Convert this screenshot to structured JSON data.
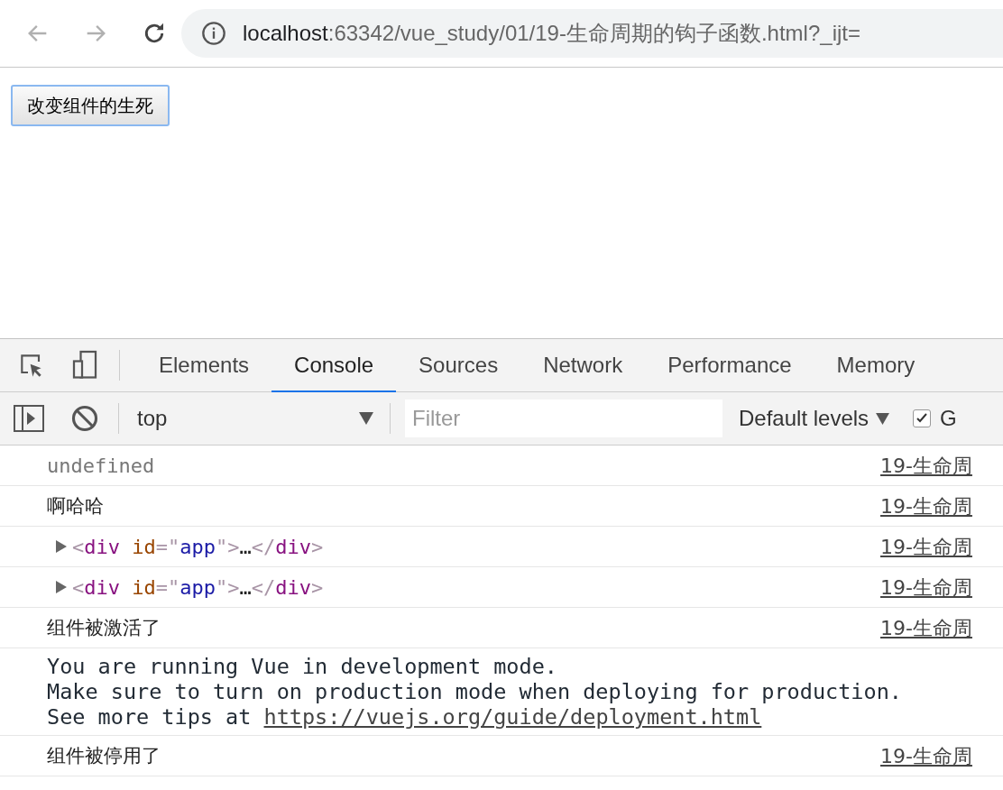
{
  "address_bar": {
    "host": "localhost",
    "path": ":63342/vue_study/01/19-生命周期的钩子函数.html?_ijt="
  },
  "page": {
    "button": "改变组件的生死"
  },
  "devtools": {
    "tabs": [
      {
        "label": "Elements",
        "selected": false
      },
      {
        "label": "Console",
        "selected": true
      },
      {
        "label": "Sources",
        "selected": false
      },
      {
        "label": "Network",
        "selected": false
      },
      {
        "label": "Performance",
        "selected": false
      },
      {
        "label": "Memory",
        "selected": false
      }
    ],
    "toolbar": {
      "context": "top",
      "filter": {
        "placeholder": "Filter"
      },
      "levels": "Default levels",
      "checkbox": {
        "label": "G",
        "checked": true
      }
    },
    "messages": [
      {
        "kind": "result",
        "text": "undefined",
        "source": "19-生命周"
      },
      {
        "kind": "log",
        "text": "啊哈哈",
        "source": "19-生命周"
      },
      {
        "kind": "element",
        "expanded": false,
        "tokens": [
          {
            "text": "<",
            "color": "#a894a6"
          },
          {
            "text": "div",
            "color": "#881280"
          },
          {
            "text": " id",
            "color": "#994500"
          },
          {
            "text": "=\"",
            "color": "#a894a6"
          },
          {
            "text": "app",
            "color": "#1a1aa6"
          },
          {
            "text": "\">",
            "color": "#a894a6"
          },
          {
            "text": "…",
            "color": "#222222"
          },
          {
            "text": "</",
            "color": "#a894a6"
          },
          {
            "text": "div",
            "color": "#881280"
          },
          {
            "text": ">",
            "color": "#a894a6"
          }
        ],
        "source": "19-生命周"
      },
      {
        "kind": "element",
        "expanded": false,
        "tokens": [
          {
            "text": "<",
            "color": "#a894a6"
          },
          {
            "text": "div",
            "color": "#881280"
          },
          {
            "text": " id",
            "color": "#994500"
          },
          {
            "text": "=\"",
            "color": "#a894a6"
          },
          {
            "text": "app",
            "color": "#1a1aa6"
          },
          {
            "text": "\">",
            "color": "#a894a6"
          },
          {
            "text": "…",
            "color": "#222222"
          },
          {
            "text": "</",
            "color": "#a894a6"
          },
          {
            "text": "div",
            "color": "#881280"
          },
          {
            "text": ">",
            "color": "#a894a6"
          }
        ],
        "source": "19-生命周"
      },
      {
        "kind": "log",
        "text": "组件被激活了",
        "source": "19-生命周"
      },
      {
        "kind": "notice",
        "lines": [
          "You are running Vue in development mode.",
          "Make sure to turn on production mode when deploying for production.",
          "See more tips at "
        ],
        "link": "https://vuejs.org/guide/deployment.html"
      },
      {
        "kind": "log",
        "text": "组件被停用了",
        "source": "19-生命周"
      }
    ]
  }
}
